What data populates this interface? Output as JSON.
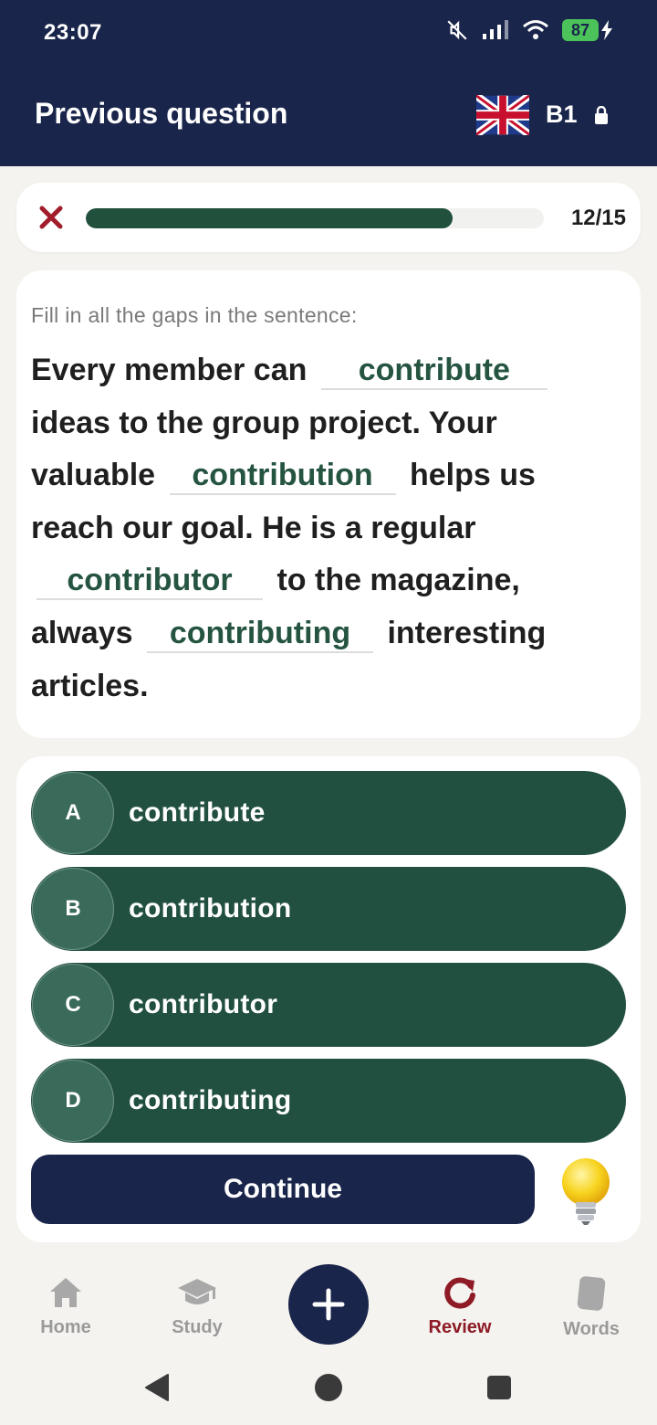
{
  "status_bar": {
    "time": "23:07",
    "battery": "87"
  },
  "header": {
    "title": "Previous question",
    "level": "B1"
  },
  "progress": {
    "counter": "12/15",
    "fraction": 0.8
  },
  "question": {
    "instruction": "Fill in all the gaps in the sentence:",
    "seg1": "Every member can",
    "gap1": "contribute",
    "seg2": "ideas to the group project. Your valuable",
    "gap2": "contribution",
    "seg3": "helps us reach our goal. He is a regular",
    "gap3": "contributor",
    "seg4": "to the magazine, always",
    "gap4": "contributing",
    "seg5": "interesting articles."
  },
  "options": [
    {
      "letter": "A",
      "label": "contribute"
    },
    {
      "letter": "B",
      "label": "contribution"
    },
    {
      "letter": "C",
      "label": "contributor"
    },
    {
      "letter": "D",
      "label": "contributing"
    }
  ],
  "actions": {
    "continue_label": "Continue"
  },
  "nav": {
    "home": "Home",
    "study": "Study",
    "review": "Review",
    "words": "Words",
    "active": "review"
  },
  "colors": {
    "navy": "#19254a",
    "green": "#225040",
    "accent_red": "#8e1b26"
  }
}
